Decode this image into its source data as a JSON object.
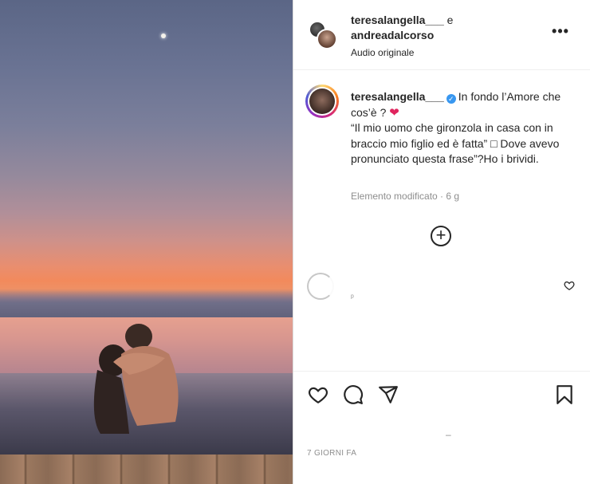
{
  "post": {
    "author_1": "teresalangella___",
    "conjunction": "e",
    "author_2": "andreadalcorso",
    "audio_label": "Audio originale",
    "more_label": "•••"
  },
  "caption": {
    "username": "teresalangella___",
    "line1": "In fondo l’Amore che cos’è ?",
    "heart": "❤",
    "line2": "“Il mio uomo che gironzola in casa con in braccio mio figlio ed è fatta” □ Dove avevo pronunciato questa frase”?Ho i brividi.",
    "meta": "Elemento modificato · 6 g"
  },
  "comments": {
    "load_more": "+",
    "placeholder": "ᵖ"
  },
  "footer": {
    "dash": "‒",
    "date": "7 GIORNI FA"
  },
  "icons": {
    "like": "heart-icon",
    "comment": "comment-bubble-icon",
    "share": "paper-plane-icon",
    "save": "bookmark-icon",
    "verified": "verified-badge-icon"
  },
  "colors": {
    "verified": "#3897f0",
    "secondary_text": "#8e8e8e",
    "primary_text": "#262626"
  }
}
